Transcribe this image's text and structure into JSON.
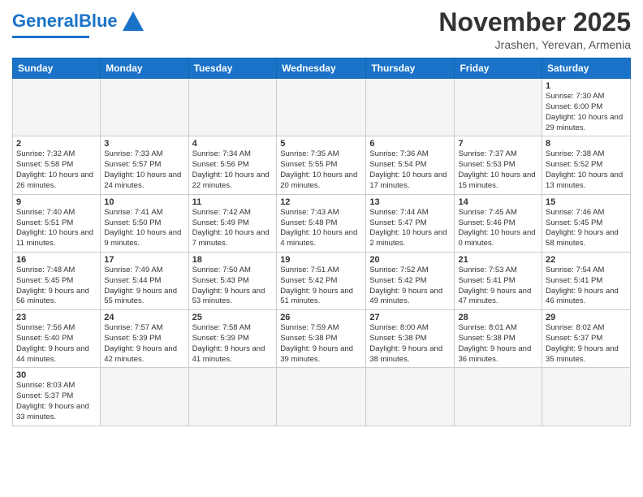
{
  "header": {
    "logo_general": "General",
    "logo_blue": "Blue",
    "month_title": "November 2025",
    "subtitle": "Jrashen, Yerevan, Armenia"
  },
  "weekdays": [
    "Sunday",
    "Monday",
    "Tuesday",
    "Wednesday",
    "Thursday",
    "Friday",
    "Saturday"
  ],
  "weeks": [
    [
      {
        "day": "",
        "info": ""
      },
      {
        "day": "",
        "info": ""
      },
      {
        "day": "",
        "info": ""
      },
      {
        "day": "",
        "info": ""
      },
      {
        "day": "",
        "info": ""
      },
      {
        "day": "",
        "info": ""
      },
      {
        "day": "1",
        "info": "Sunrise: 7:30 AM\nSunset: 6:00 PM\nDaylight: 10 hours and 29 minutes."
      }
    ],
    [
      {
        "day": "2",
        "info": "Sunrise: 7:32 AM\nSunset: 5:58 PM\nDaylight: 10 hours and 26 minutes."
      },
      {
        "day": "3",
        "info": "Sunrise: 7:33 AM\nSunset: 5:57 PM\nDaylight: 10 hours and 24 minutes."
      },
      {
        "day": "4",
        "info": "Sunrise: 7:34 AM\nSunset: 5:56 PM\nDaylight: 10 hours and 22 minutes."
      },
      {
        "day": "5",
        "info": "Sunrise: 7:35 AM\nSunset: 5:55 PM\nDaylight: 10 hours and 20 minutes."
      },
      {
        "day": "6",
        "info": "Sunrise: 7:36 AM\nSunset: 5:54 PM\nDaylight: 10 hours and 17 minutes."
      },
      {
        "day": "7",
        "info": "Sunrise: 7:37 AM\nSunset: 5:53 PM\nDaylight: 10 hours and 15 minutes."
      },
      {
        "day": "8",
        "info": "Sunrise: 7:38 AM\nSunset: 5:52 PM\nDaylight: 10 hours and 13 minutes."
      }
    ],
    [
      {
        "day": "9",
        "info": "Sunrise: 7:40 AM\nSunset: 5:51 PM\nDaylight: 10 hours and 11 minutes."
      },
      {
        "day": "10",
        "info": "Sunrise: 7:41 AM\nSunset: 5:50 PM\nDaylight: 10 hours and 9 minutes."
      },
      {
        "day": "11",
        "info": "Sunrise: 7:42 AM\nSunset: 5:49 PM\nDaylight: 10 hours and 7 minutes."
      },
      {
        "day": "12",
        "info": "Sunrise: 7:43 AM\nSunset: 5:48 PM\nDaylight: 10 hours and 4 minutes."
      },
      {
        "day": "13",
        "info": "Sunrise: 7:44 AM\nSunset: 5:47 PM\nDaylight: 10 hours and 2 minutes."
      },
      {
        "day": "14",
        "info": "Sunrise: 7:45 AM\nSunset: 5:46 PM\nDaylight: 10 hours and 0 minutes."
      },
      {
        "day": "15",
        "info": "Sunrise: 7:46 AM\nSunset: 5:45 PM\nDaylight: 9 hours and 58 minutes."
      }
    ],
    [
      {
        "day": "16",
        "info": "Sunrise: 7:48 AM\nSunset: 5:45 PM\nDaylight: 9 hours and 56 minutes."
      },
      {
        "day": "17",
        "info": "Sunrise: 7:49 AM\nSunset: 5:44 PM\nDaylight: 9 hours and 55 minutes."
      },
      {
        "day": "18",
        "info": "Sunrise: 7:50 AM\nSunset: 5:43 PM\nDaylight: 9 hours and 53 minutes."
      },
      {
        "day": "19",
        "info": "Sunrise: 7:51 AM\nSunset: 5:42 PM\nDaylight: 9 hours and 51 minutes."
      },
      {
        "day": "20",
        "info": "Sunrise: 7:52 AM\nSunset: 5:42 PM\nDaylight: 9 hours and 49 minutes."
      },
      {
        "day": "21",
        "info": "Sunrise: 7:53 AM\nSunset: 5:41 PM\nDaylight: 9 hours and 47 minutes."
      },
      {
        "day": "22",
        "info": "Sunrise: 7:54 AM\nSunset: 5:41 PM\nDaylight: 9 hours and 46 minutes."
      }
    ],
    [
      {
        "day": "23",
        "info": "Sunrise: 7:56 AM\nSunset: 5:40 PM\nDaylight: 9 hours and 44 minutes."
      },
      {
        "day": "24",
        "info": "Sunrise: 7:57 AM\nSunset: 5:39 PM\nDaylight: 9 hours and 42 minutes."
      },
      {
        "day": "25",
        "info": "Sunrise: 7:58 AM\nSunset: 5:39 PM\nDaylight: 9 hours and 41 minutes."
      },
      {
        "day": "26",
        "info": "Sunrise: 7:59 AM\nSunset: 5:38 PM\nDaylight: 9 hours and 39 minutes."
      },
      {
        "day": "27",
        "info": "Sunrise: 8:00 AM\nSunset: 5:38 PM\nDaylight: 9 hours and 38 minutes."
      },
      {
        "day": "28",
        "info": "Sunrise: 8:01 AM\nSunset: 5:38 PM\nDaylight: 9 hours and 36 minutes."
      },
      {
        "day": "29",
        "info": "Sunrise: 8:02 AM\nSunset: 5:37 PM\nDaylight: 9 hours and 35 minutes."
      }
    ],
    [
      {
        "day": "30",
        "info": "Sunrise: 8:03 AM\nSunset: 5:37 PM\nDaylight: 9 hours and 33 minutes."
      },
      {
        "day": "",
        "info": ""
      },
      {
        "day": "",
        "info": ""
      },
      {
        "day": "",
        "info": ""
      },
      {
        "day": "",
        "info": ""
      },
      {
        "day": "",
        "info": ""
      },
      {
        "day": "",
        "info": ""
      }
    ]
  ]
}
